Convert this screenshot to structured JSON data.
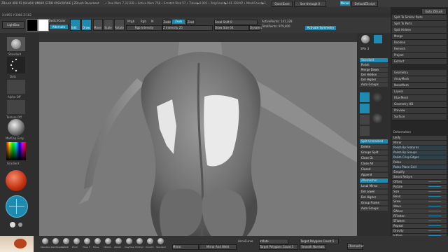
{
  "app": {
    "title": "ZBrush 4R8 P2 (64x64) UMIHR GFDB VASVXHVHE | ZBrush Document",
    "title_stats": "• Free Mem 7.311GB • Active Mem 758 • Scratch Disk 57 • Timer▶0.001 • PolyCount▶141.328 KP • MeshCount▶1",
    "quicksave_label": "QuickSave",
    "seethrough_label": "See-through 0",
    "menus_label": "Menus",
    "defaultscript_label": "DefaultZScript"
  },
  "menubar": [
    "Alpha",
    "Brush",
    "Color",
    "Document",
    "Draw",
    "Edit",
    "File",
    "Layer",
    "Light",
    "Macro",
    "Marker",
    "Material",
    "Movie",
    "Picker",
    "Preferences",
    "Render",
    "Stencil",
    "Stroke",
    "Texture",
    "Tool",
    "Transform",
    "Zplugin",
    "Zscript",
    "Help"
  ],
  "infobar": "X:4955 Y:3066 Z:162",
  "toolbar": {
    "lightbox": "LightBox",
    "switch_color": "SwitchColor",
    "gradient": "Gradient",
    "alternate": "Alternate",
    "edit": "Edit",
    "draw": "Draw",
    "move": "Move",
    "scale": "Scale",
    "rotate": "Rotate",
    "mrgb": "Mrgb",
    "rgb": "Rgb",
    "m": "M",
    "zadd": "Zadd",
    "zsub": "Zsub",
    "zcut": "Zcut",
    "rgb_intensity": "Rgb Intensity",
    "z_intensity": "Z Intensity 25",
    "focal_shift": "Focal Shift 0",
    "draw_size": "Draw Size 64",
    "dynamic": "Dynamic",
    "active_points": "ActivePoints: 141,328",
    "total_points": "TotalPoints: 979,400",
    "activate_symmetry": "Activate Symmetry"
  },
  "left_shelf": {
    "standard": "Standard",
    "dots": "Dots",
    "alpha_off": "Alpha Off",
    "texture_off": "Texture Off",
    "material": "MatCap Gray",
    "gradient": "Gradient"
  },
  "right_shelf": {
    "spix": "SPix 3",
    "lsym": "L.Sym",
    "persp": "Persp",
    "floor": "Floor",
    "local": "Local",
    "frame": "Frame",
    "move": "Move",
    "scale": "Scale",
    "rotate": "Rotate",
    "polyf": "PolyF",
    "transp": "Transp",
    "xyz": "Xyz",
    "ghost": "Ghost",
    "solo": "Solo",
    "dynamic": "Dynamic"
  },
  "right_panel": {
    "gotoz": "Goto ZBrush",
    "top_items": [
      "Split To Similar Parts",
      "Split To Parts",
      "Split Hidden"
    ],
    "subtool_items": [
      "Merge",
      "Boolean",
      "Remesh",
      "Project",
      "Extract"
    ],
    "sections": [
      "Geometry",
      "ArrayMesh",
      "NanoMesh",
      "Layers",
      "FiberMesh",
      "Geometry HD",
      "Preview",
      "Surface"
    ],
    "deformation_header": "Deformation",
    "deformation_items": [
      "Unify",
      "Mirror",
      "Polish By Features",
      "Polish By Groups",
      "Polish Crisp Edges",
      "Relax",
      "Relax Plane Grid",
      "Simplify",
      "Smart ReSym",
      "Offset",
      "Rotate",
      "Size",
      "Bend",
      "Skew",
      "Wave",
      "SWave",
      "RFlatten",
      "SFlatten",
      "Repeat",
      "Gravity",
      "Inflate",
      "Spherize"
    ]
  },
  "middle_column": {
    "items": [
      "Standard",
      "Polish",
      "Merge Down",
      "Del Hidden",
      "Del Higher",
      "Auto Groups",
      "Split Unmasked",
      "Delete",
      "Groups Split",
      "Close Gt",
      "Close All",
      "Closed",
      "Append",
      "ZRemesher",
      "Local Mirror",
      "Del Lower",
      "Del Higher",
      "Group Frame",
      "Auto Groups"
    ],
    "spix": "SPix 3",
    "dyna": "DynaMesh",
    "poly": "PolyGroup"
  },
  "bottom": {
    "brushes": [
      "Standard",
      "DamDisplay",
      "InflatD",
      "Pinch",
      "Move T",
      "Move",
      "hPolish",
      "sPolish",
      "ClayTube",
      "TrimDyn",
      "Smooth",
      "Standard"
    ],
    "mirror": "Mirror",
    "mirror_weld": "Mirror And Weld",
    "accucurve": "AccuCurve",
    "inflate": "Inflate",
    "target_count": "Target Polygons Count 5",
    "target_count2": "Target Polygons Count 5",
    "smooth_normals": "Smooth Normals",
    "zremesher": "ZRemesher"
  },
  "colors": {
    "accent": "#1f8ab0",
    "canvas_bg": "#7a7a7a",
    "mesh": "#8c8c8c"
  }
}
